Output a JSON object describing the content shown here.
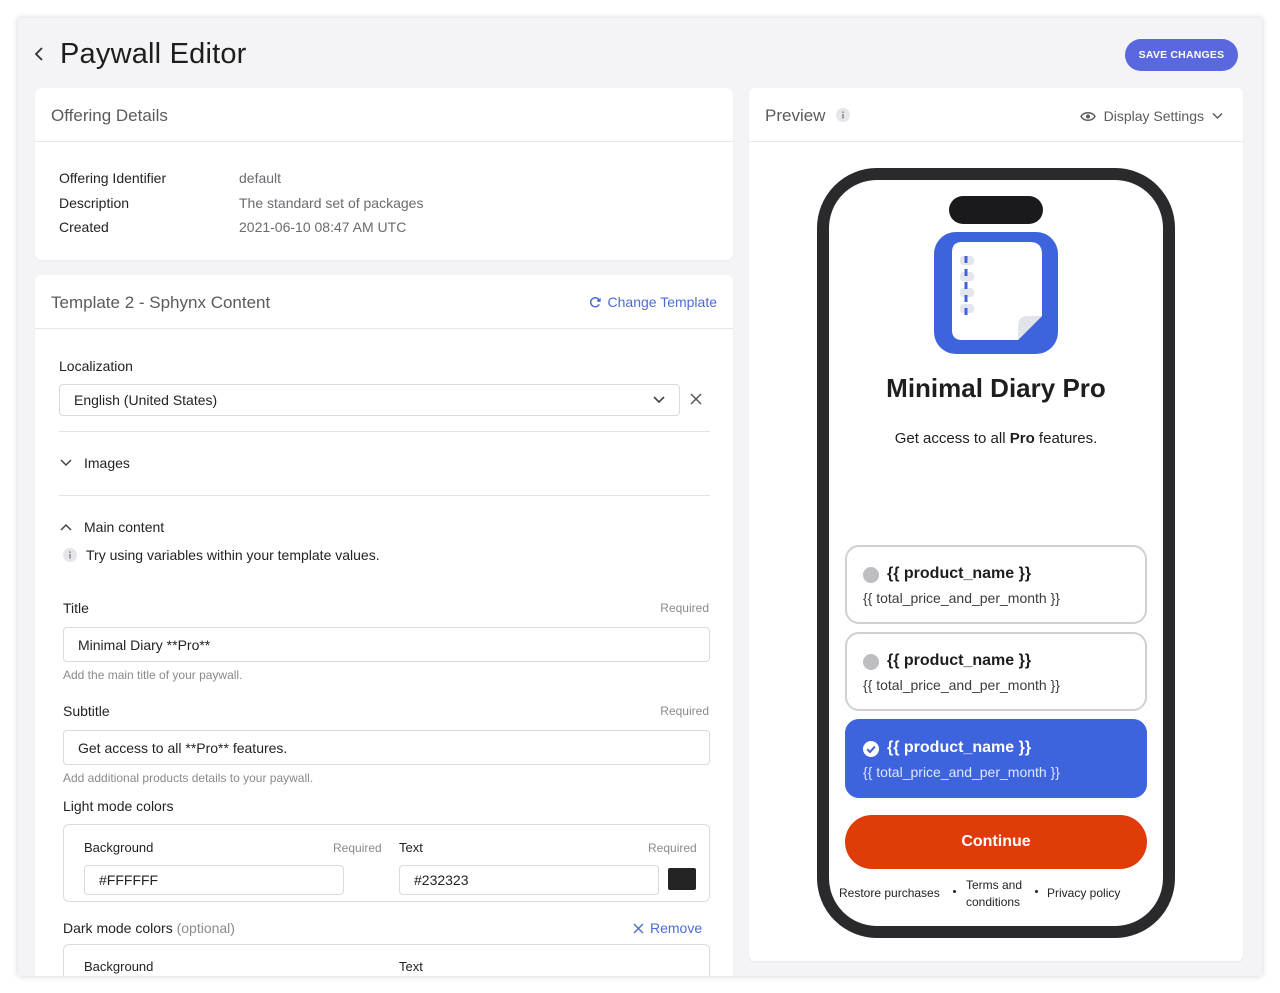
{
  "header": {
    "title": "Paywall Editor",
    "save_label": "SAVE CHANGES"
  },
  "offering": {
    "title": "Offering Details",
    "rows": [
      {
        "key": "Offering Identifier",
        "value": "default"
      },
      {
        "key": "Description",
        "value": "The standard set of packages"
      },
      {
        "key": "Created",
        "value": "2021-06-10 08:47 AM UTC"
      }
    ]
  },
  "template": {
    "title": "Template 2 - Sphynx Content",
    "change_label": "Change Template",
    "localization_label": "Localization",
    "localization_value": "English (United States)",
    "images_label": "Images",
    "main_content_label": "Main content",
    "hint": "Try using variables within your template values.",
    "title_field": {
      "label": "Title",
      "required": "Required",
      "value": "Minimal Diary **Pro**",
      "help": "Add the main title of your paywall."
    },
    "subtitle_field": {
      "label": "Subtitle",
      "required": "Required",
      "value": "Get access to all **Pro** features.",
      "help": "Add additional products details to your paywall."
    },
    "light_colors": {
      "label": "Light mode colors",
      "background_label": "Background",
      "background_required": "Required",
      "background_value": "#FFFFFF",
      "text_label": "Text",
      "text_required": "Required",
      "text_value": "#232323",
      "swatch": "#232323"
    },
    "dark_colors": {
      "label": "Dark mode colors",
      "optional": "(optional)",
      "remove_label": "Remove",
      "background_label": "Background",
      "text_label": "Text"
    }
  },
  "preview": {
    "title": "Preview",
    "display_settings": "Display Settings",
    "app_title_plain": "Minimal Diary",
    "app_title_bold": "Pro",
    "subtitle_pre": "Get access to all ",
    "subtitle_bold": "Pro",
    "subtitle_post": " features.",
    "packages": [
      {
        "name": "{{ product_name }}",
        "price": "{{ total_price_and_per_month }}",
        "selected": false
      },
      {
        "name": "{{ product_name }}",
        "price": "{{ total_price_and_per_month }}",
        "selected": false
      },
      {
        "name": "{{ product_name }}",
        "price": "{{ total_price_and_per_month }}",
        "selected": true
      }
    ],
    "continue_label": "Continue",
    "restore_label": "Restore purchases",
    "terms_label_1": "Terms and",
    "terms_label_2": "conditions",
    "privacy_label": "Privacy policy"
  },
  "colors": {
    "accent": "#5a68e0",
    "link": "#4c6bd8",
    "package_selected": "#3d63dd",
    "continue": "#e03c0a",
    "icon_blue": "#3d63dd"
  }
}
